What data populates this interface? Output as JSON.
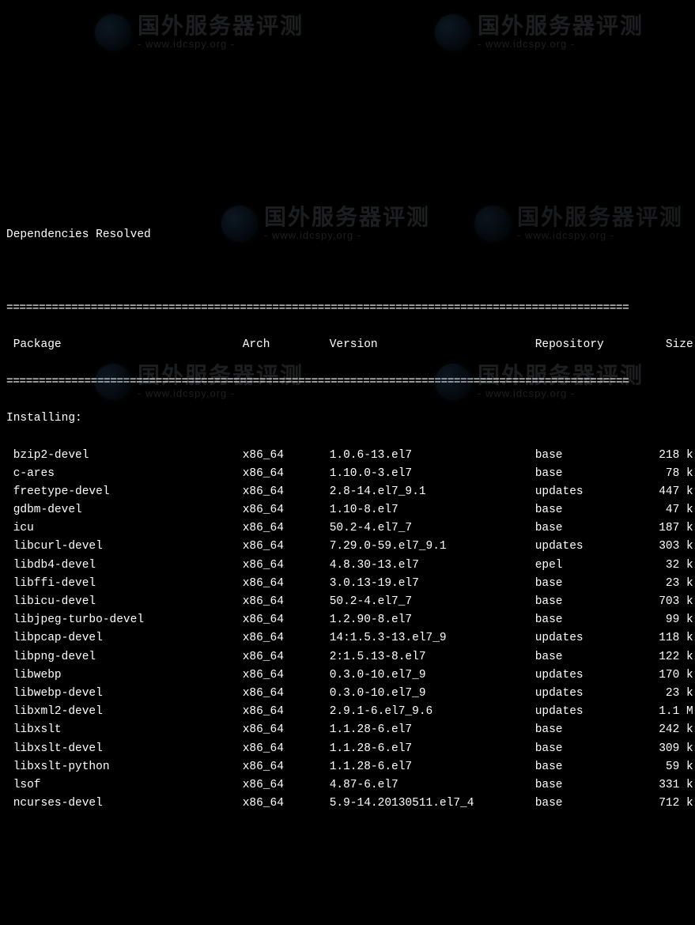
{
  "header_line": "Dependencies Resolved",
  "divider": "================================================================================================",
  "columns": {
    "pkg": "Package",
    "arch": "Arch",
    "ver": "Version",
    "repo": "Repository",
    "size": "Size"
  },
  "section": "Installing:",
  "watermark": {
    "text_big": "国外服务器评测",
    "text_small": "- www.idcspy.org -"
  },
  "rows": [
    {
      "pkg": "bzip2-devel",
      "arch": "x86_64",
      "ver": "1.0.6-13.el7",
      "repo": "base",
      "size": "218 k"
    },
    {
      "pkg": "c-ares",
      "arch": "x86_64",
      "ver": "1.10.0-3.el7",
      "repo": "base",
      "size": "78 k"
    },
    {
      "pkg": "freetype-devel",
      "arch": "x86_64",
      "ver": "2.8-14.el7_9.1",
      "repo": "updates",
      "size": "447 k"
    },
    {
      "pkg": "gdbm-devel",
      "arch": "x86_64",
      "ver": "1.10-8.el7",
      "repo": "base",
      "size": "47 k"
    },
    {
      "pkg": "icu",
      "arch": "x86_64",
      "ver": "50.2-4.el7_7",
      "repo": "base",
      "size": "187 k"
    },
    {
      "pkg": "libcurl-devel",
      "arch": "x86_64",
      "ver": "7.29.0-59.el7_9.1",
      "repo": "updates",
      "size": "303 k"
    },
    {
      "pkg": "libdb4-devel",
      "arch": "x86_64",
      "ver": "4.8.30-13.el7",
      "repo": "epel",
      "size": "32 k"
    },
    {
      "pkg": "libffi-devel",
      "arch": "x86_64",
      "ver": "3.0.13-19.el7",
      "repo": "base",
      "size": "23 k"
    },
    {
      "pkg": "libicu-devel",
      "arch": "x86_64",
      "ver": "50.2-4.el7_7",
      "repo": "base",
      "size": "703 k"
    },
    {
      "pkg": "libjpeg-turbo-devel",
      "arch": "x86_64",
      "ver": "1.2.90-8.el7",
      "repo": "base",
      "size": "99 k"
    },
    {
      "pkg": "libpcap-devel",
      "arch": "x86_64",
      "ver": "14:1.5.3-13.el7_9",
      "repo": "updates",
      "size": "118 k"
    },
    {
      "pkg": "libpng-devel",
      "arch": "x86_64",
      "ver": "2:1.5.13-8.el7",
      "repo": "base",
      "size": "122 k"
    },
    {
      "pkg": "libwebp",
      "arch": "x86_64",
      "ver": "0.3.0-10.el7_9",
      "repo": "updates",
      "size": "170 k"
    },
    {
      "pkg": "libwebp-devel",
      "arch": "x86_64",
      "ver": "0.3.0-10.el7_9",
      "repo": "updates",
      "size": "23 k"
    },
    {
      "pkg": "libxml2-devel",
      "arch": "x86_64",
      "ver": "2.9.1-6.el7_9.6",
      "repo": "updates",
      "size": "1.1 M"
    },
    {
      "pkg": "libxslt",
      "arch": "x86_64",
      "ver": "1.1.28-6.el7",
      "repo": "base",
      "size": "242 k"
    },
    {
      "pkg": "libxslt-devel",
      "arch": "x86_64",
      "ver": "1.1.28-6.el7",
      "repo": "base",
      "size": "309 k"
    },
    {
      "pkg": "libxslt-python",
      "arch": "x86_64",
      "ver": "1.1.28-6.el7",
      "repo": "base",
      "size": "59 k"
    },
    {
      "pkg": "lsof",
      "arch": "x86_64",
      "ver": "4.87-6.el7",
      "repo": "base",
      "size": "331 k"
    },
    {
      "pkg": "ncurses-devel",
      "arch": "x86_64",
      "ver": "5.9-14.20130511.el7_4",
      "repo": "base",
      "size": "712 k"
    }
  ]
}
